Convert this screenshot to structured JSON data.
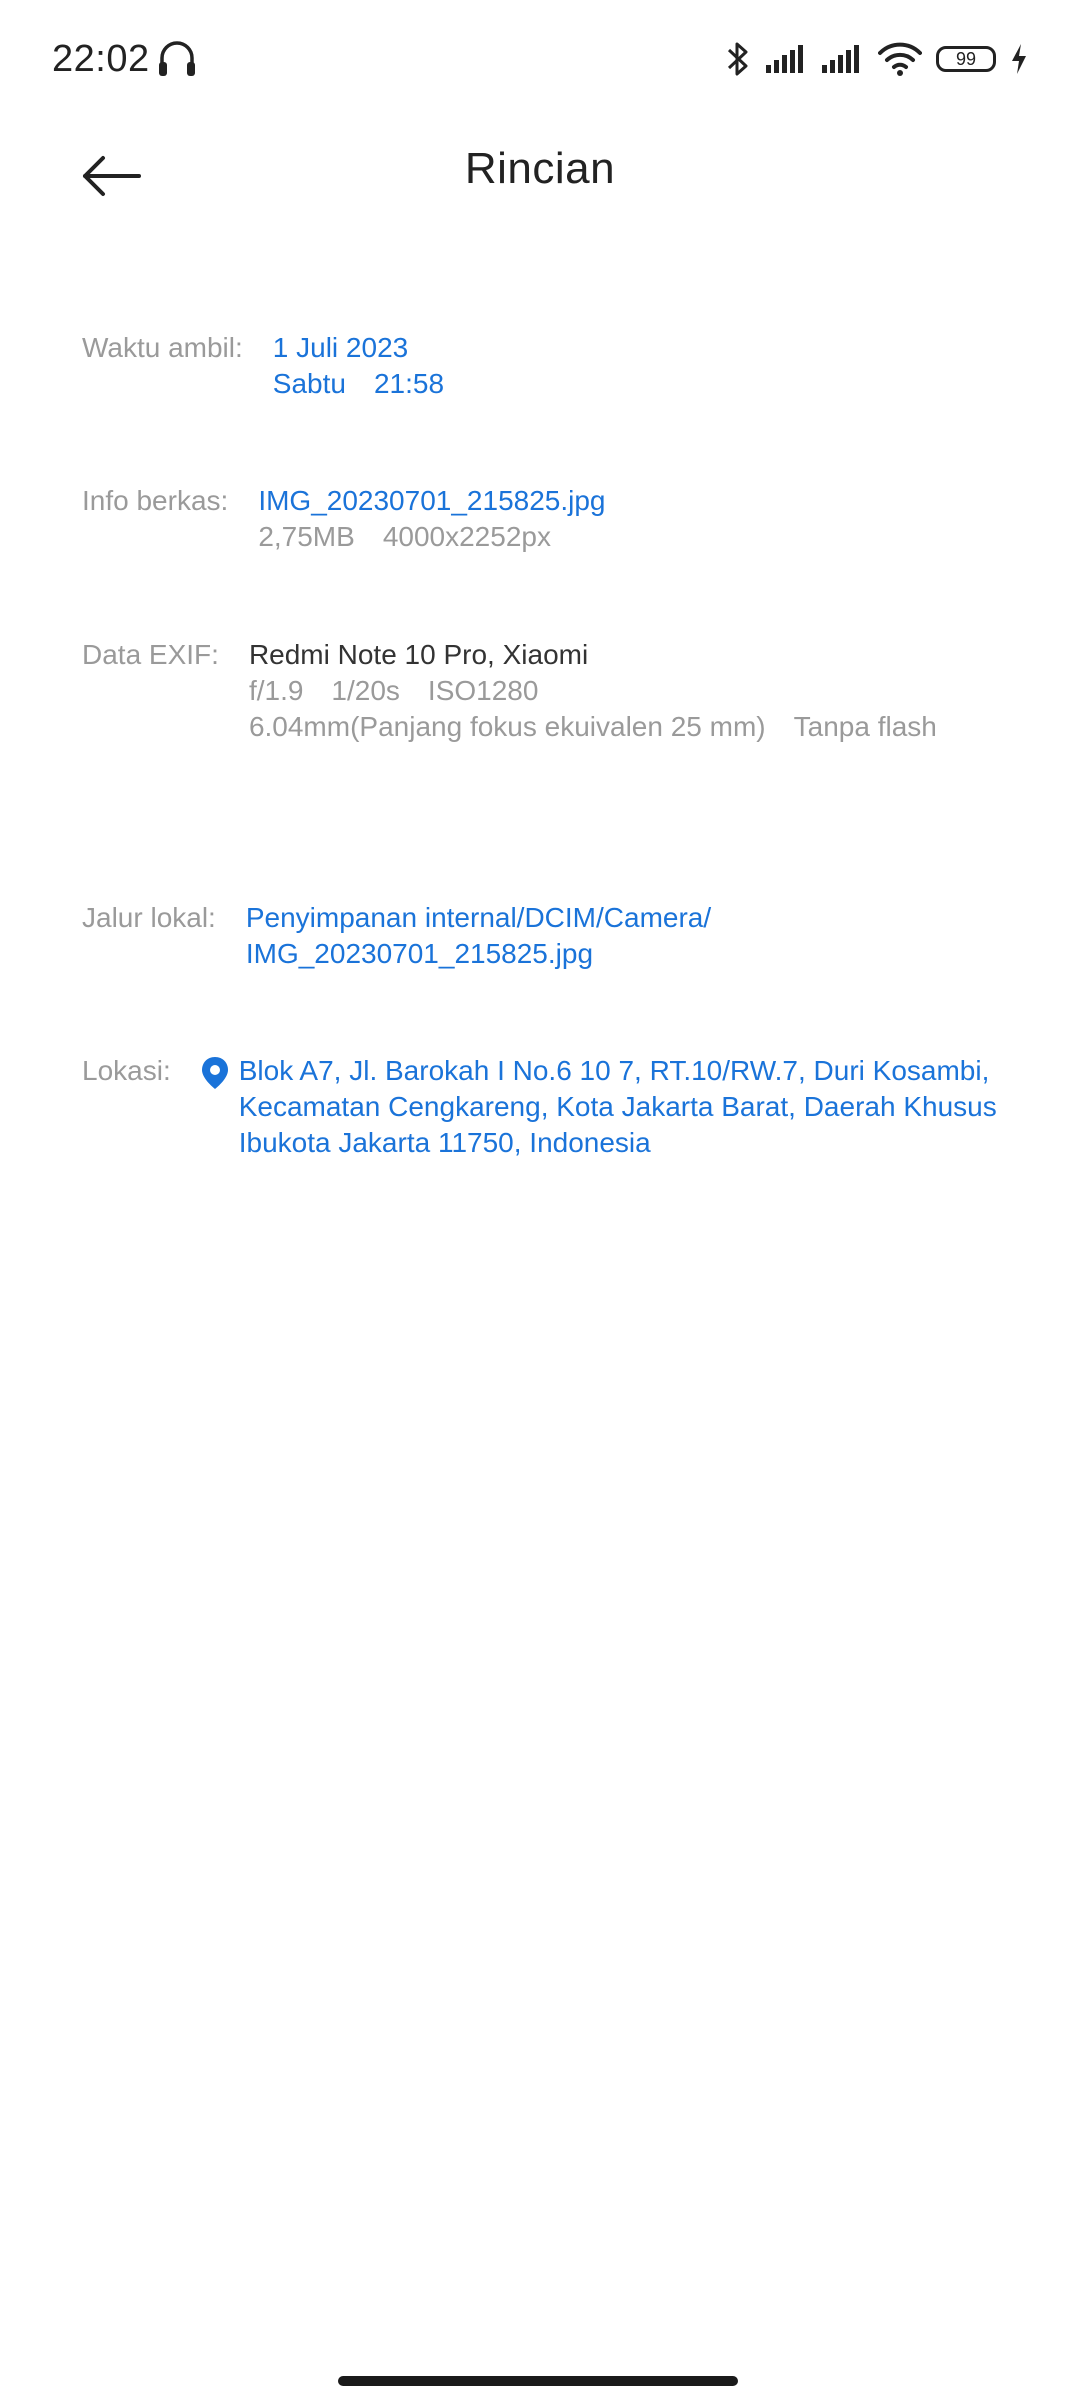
{
  "status_bar": {
    "time": "22:02",
    "battery": "99",
    "icons": [
      "headset-icon",
      "bluetooth-icon",
      "signal-icon",
      "signal-icon",
      "wifi-icon",
      "battery-icon",
      "charging-icon"
    ]
  },
  "header": {
    "title": "Rincian",
    "back_icon": "arrow-left-icon"
  },
  "details": {
    "waktu": {
      "label": "Waktu ambil:",
      "date": "1 Juli 2023",
      "day": "Sabtu",
      "time": "21:58"
    },
    "info": {
      "label": "Info berkas:",
      "filename": "IMG_20230701_215825.jpg",
      "size": "2,75MB",
      "resolution": "4000x2252px"
    },
    "exif": {
      "label": "Data EXIF:",
      "device": "Redmi Note 10 Pro, Xiaomi",
      "aperture": "f/1.9",
      "shutter": "1/20s",
      "iso": "ISO1280",
      "focal": "6.04mm(Panjang fokus ekuivalen 25 mm)",
      "flash": "Tanpa flash"
    },
    "path": {
      "label": "Jalur lokal:",
      "line1": "Penyimpanan internal/DCIM/Camera/",
      "line2": "IMG_20230701_215825.jpg"
    },
    "location": {
      "label": "Lokasi:",
      "icon": "location-pin-icon",
      "address": "Blok A7, Jl. Barokah I No.6 10 7, RT.10/RW.7, Duri Kosambi, Kecamatan Cengkareng, Kota Jakarta Barat, Daerah Khusus Ibukota Jakarta 11750, Indonesia"
    }
  },
  "colors": {
    "accent": "#1a73d9",
    "label": "#9a9a9a",
    "text": "#333333"
  }
}
